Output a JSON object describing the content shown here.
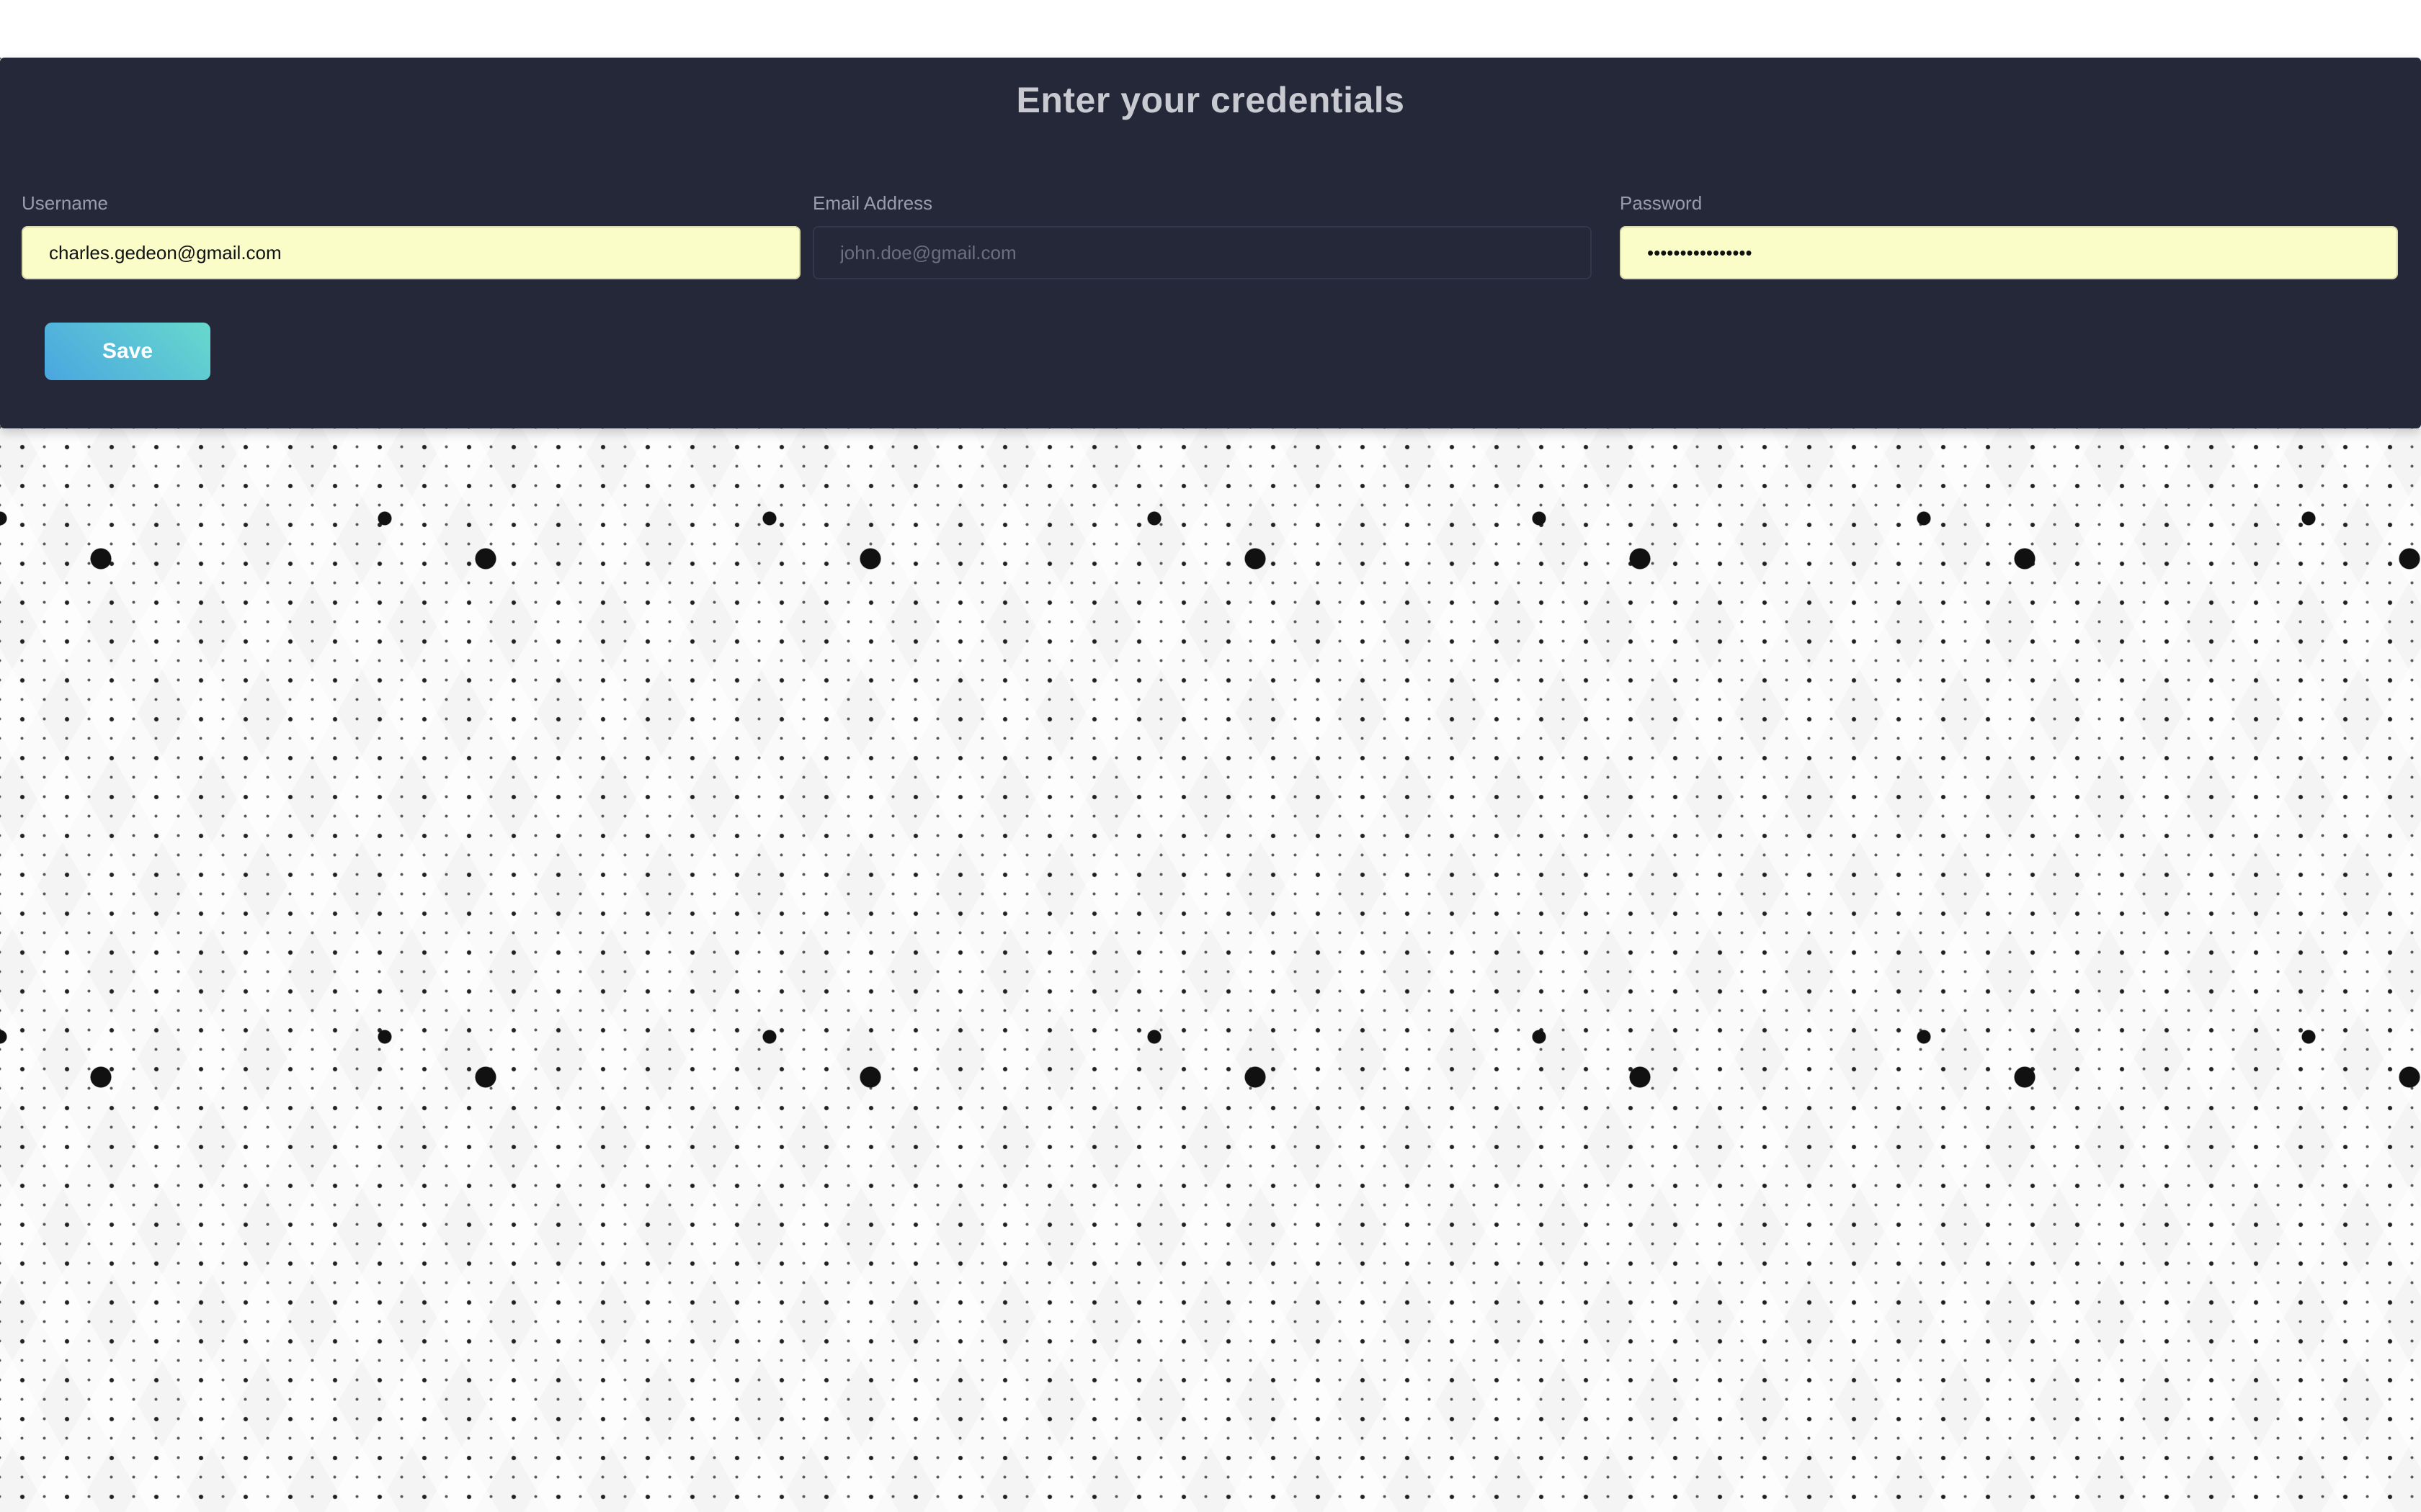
{
  "form": {
    "title": "Enter your credentials",
    "fields": {
      "username": {
        "label": "Username",
        "value": "charles.gedeon@gmail.com",
        "placeholder": ""
      },
      "email": {
        "label": "Email Address",
        "value": "",
        "placeholder": "john.doe@gmail.com"
      },
      "password": {
        "label": "Password",
        "value": "passwordpassword",
        "placeholder": ""
      }
    },
    "save_label": "Save"
  },
  "colors": {
    "panel_background": "#252838",
    "autofill_background": "#fafdc8",
    "button_gradient_start": "#4aa6e0",
    "button_gradient_end": "#67d9cd",
    "page_background": "#f4f4f4"
  }
}
